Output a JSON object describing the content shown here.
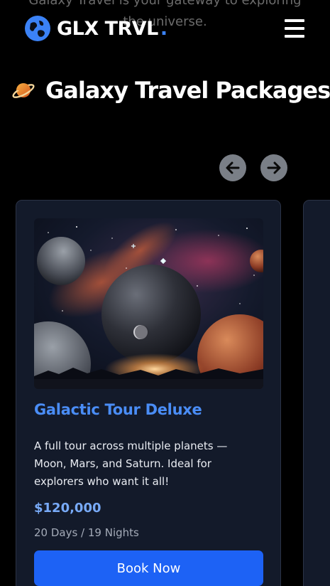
{
  "hero": {
    "behind_line1": "Galaxy Travel is your gateway to exploring",
    "behind_line2": "the universe."
  },
  "navbar": {
    "brand": "GLX TRVL",
    "brand_dot": ".",
    "logo_icon": "globe-icon",
    "menu_icon": "hamburger-menu-icon"
  },
  "section": {
    "title": "Galaxy Travel Packages",
    "title_icon": "planet-icon"
  },
  "carousel": {
    "prev_icon": "arrow-left-icon",
    "next_icon": "arrow-right-icon"
  },
  "packages": [
    {
      "title": "Galactic Tour Deluxe",
      "description": "A full tour across multiple planets — Moon, Mars, and Saturn. Ideal for explorers who want it all!",
      "price": "$120,000",
      "duration": "20 Days / 19 Nights",
      "cta": "Book Now"
    }
  ],
  "colors": {
    "accent": "#1d62f5",
    "title_blue": "#4a8df6",
    "price_blue": "#78aaf7",
    "card_bg": "#131a2a",
    "page_bg": "#000000"
  }
}
